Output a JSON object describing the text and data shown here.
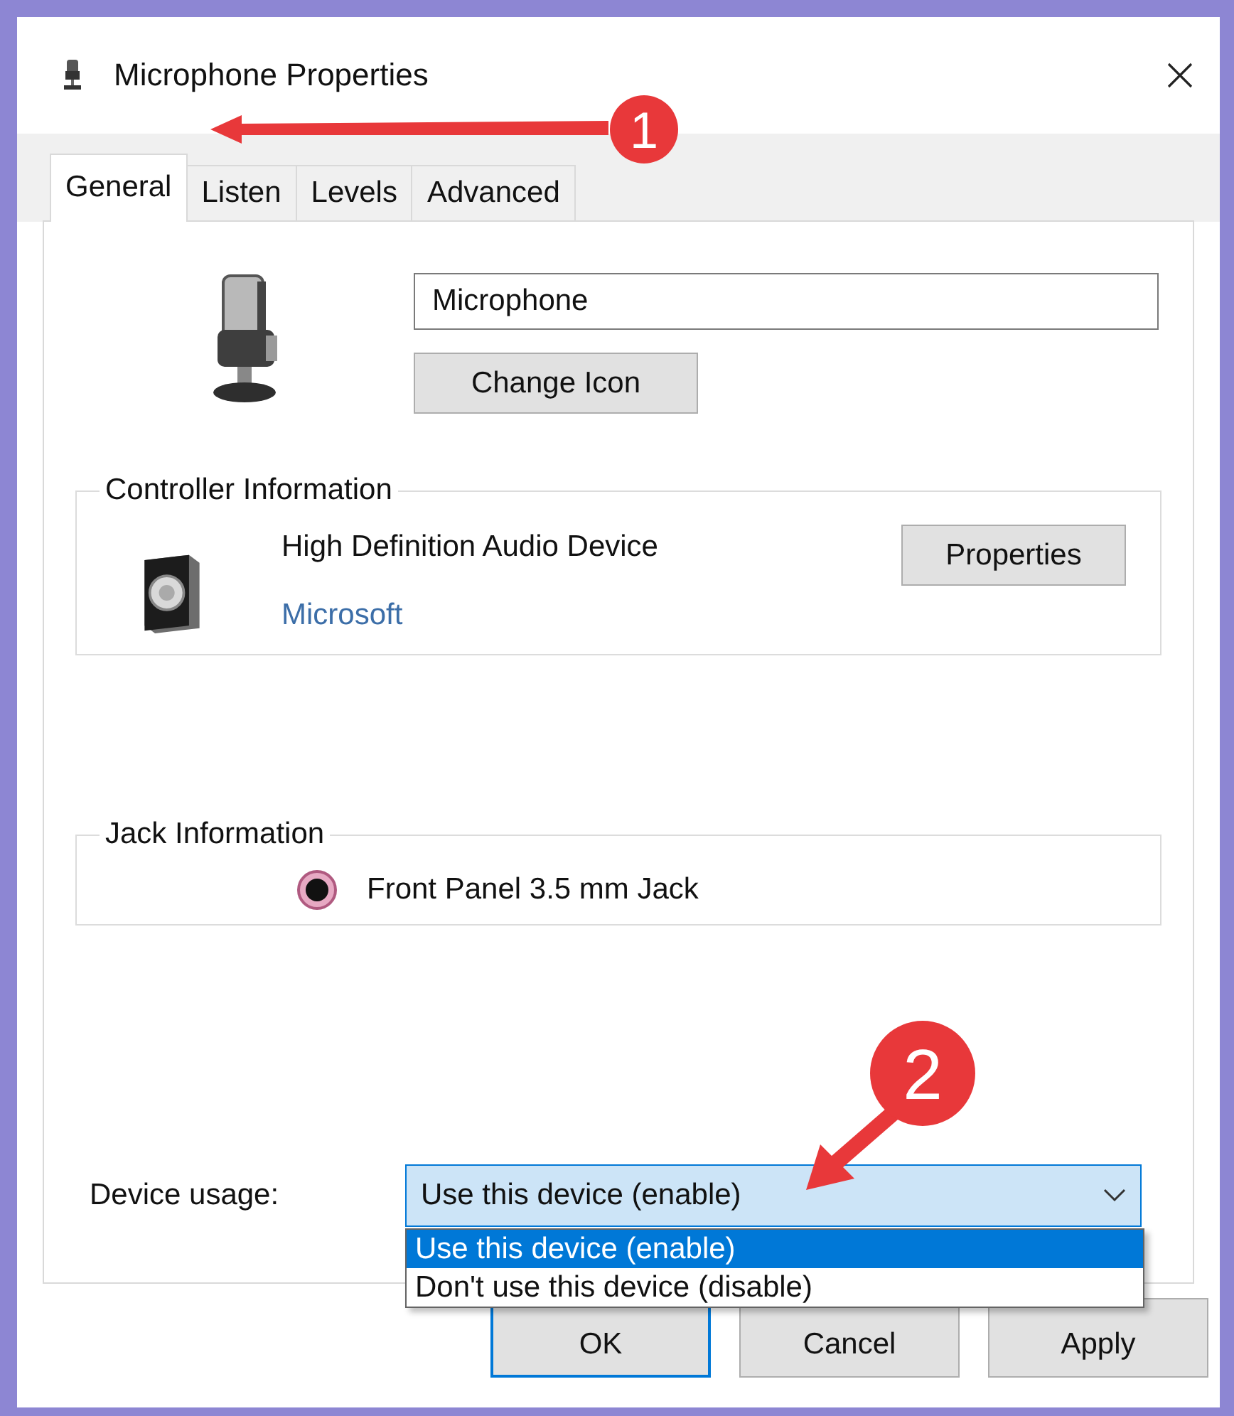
{
  "window": {
    "title": "Microphone Properties"
  },
  "tabs": [
    {
      "label": "General",
      "selected": true
    },
    {
      "label": "Listen",
      "selected": false
    },
    {
      "label": "Levels",
      "selected": false
    },
    {
      "label": "Advanced",
      "selected": false
    }
  ],
  "device": {
    "name_value": "Microphone",
    "change_icon_button": "Change Icon"
  },
  "controller_information": {
    "legend": "Controller Information",
    "device": "High Definition Audio Device",
    "vendor": "Microsoft",
    "properties_button": "Properties"
  },
  "jack_information": {
    "legend": "Jack Information",
    "jack": "Front Panel 3.5 mm Jack"
  },
  "device_usage": {
    "label": "Device usage:",
    "value": "Use this device (enable)",
    "expanded": true,
    "options": [
      {
        "label": "Use this device (enable)",
        "selected": true
      },
      {
        "label": "Don't use this device (disable)",
        "selected": false
      }
    ]
  },
  "buttons": [
    "OK",
    "Cancel",
    "Apply"
  ],
  "annotations": [
    {
      "number": "1"
    },
    {
      "number": "2"
    }
  ]
}
